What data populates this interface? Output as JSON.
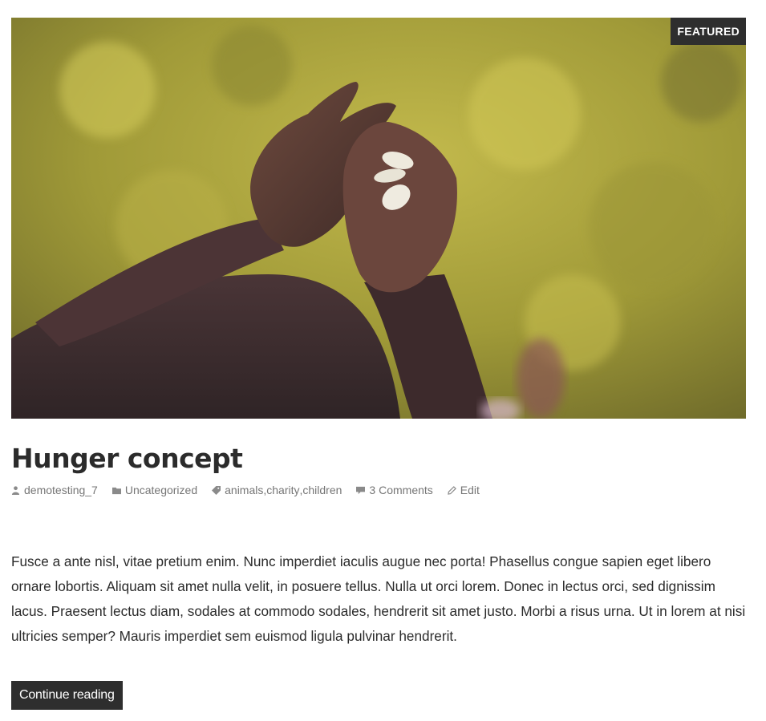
{
  "post": {
    "badge": "FEATURED",
    "title": "Hunger concept",
    "meta": {
      "author": "demotesting_7",
      "category": "Uncategorized",
      "tags": [
        "animals",
        "charity",
        "children"
      ],
      "tag_separator": ", ",
      "comments": "3 Comments",
      "edit": "Edit"
    },
    "excerpt": "Fusce a ante nisl, vitae pretium enim. Nunc imperdiet iaculis augue nec porta! Phasellus congue sapien eget libero ornare lobortis. Aliquam sit amet nulla velit, in posuere tellus. Nulla ut orci lorem. Donec in lectus orci, sed dignissim lacus. Praesent lectus diam, sodales at commodo sodales, hendrerit sit amet justo. Morbi a risus urna. Ut in lorem at nisi ultricies semper? Mauris imperdiet sem euismod ligula pulvinar hendrerit.",
    "continue_label": "Continue reading"
  },
  "icons": {
    "author": "person-icon",
    "category": "folder-icon",
    "tags": "tag-icon",
    "comments": "comment-bubble-icon",
    "edit": "pencil-icon"
  },
  "colors": {
    "text": "#2b2b2b",
    "meta": "#767676",
    "badge_bg": "#2e2e2e",
    "button_bg": "#2e2e2e",
    "background_green": "#a8a23c"
  }
}
